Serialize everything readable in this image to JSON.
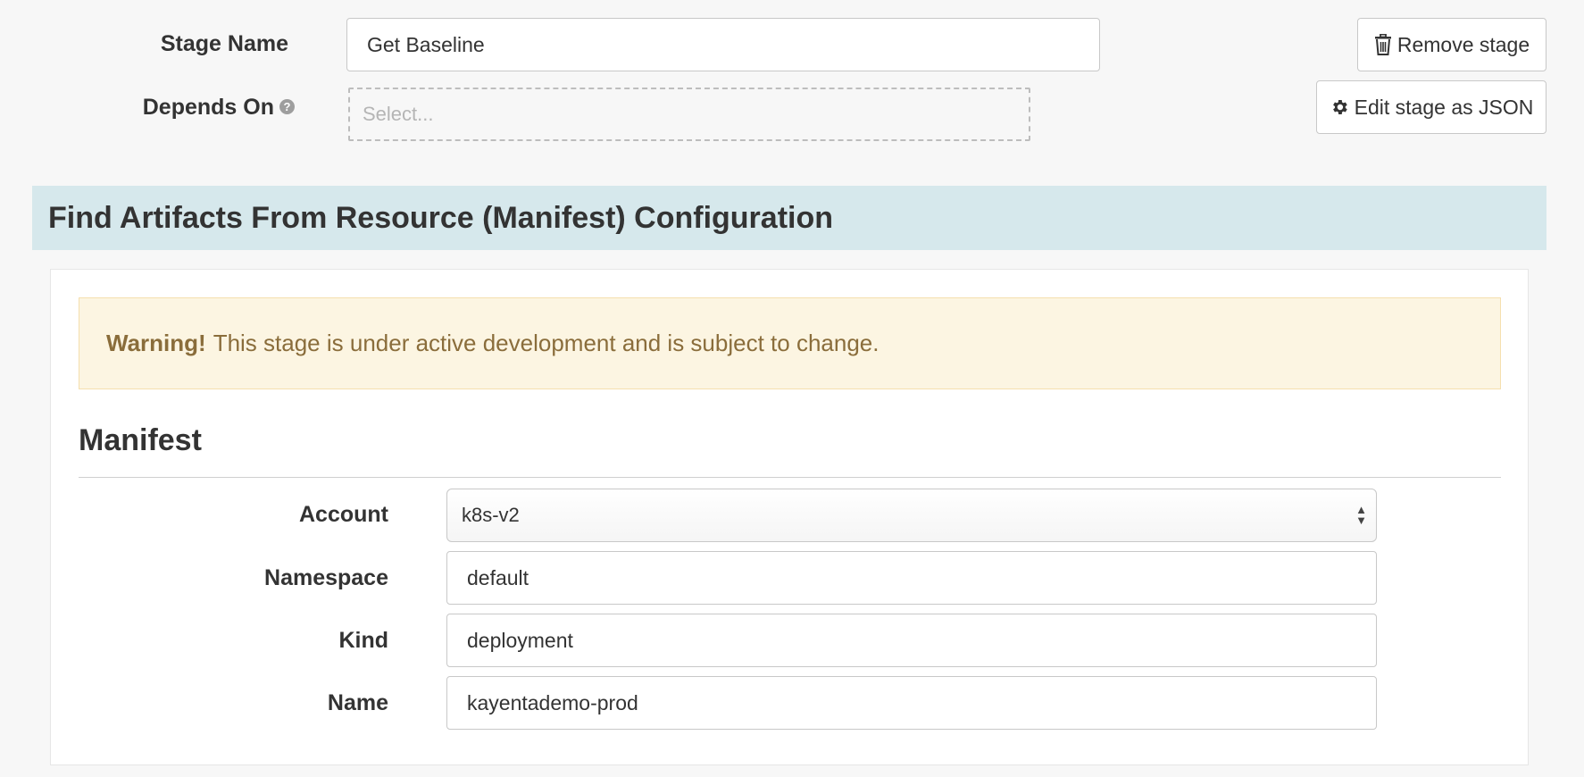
{
  "stage": {
    "name_label": "Stage Name",
    "name_value": "Get Baseline",
    "depends_label": "Depends On",
    "depends_placeholder": "Select...",
    "remove_button": "Remove stage",
    "edit_json_button": "Edit stage as JSON"
  },
  "section": {
    "title": "Find Artifacts From Resource (Manifest) Configuration"
  },
  "warning": {
    "strong": "Warning!",
    "text": "This stage is under active development and is subject to change."
  },
  "manifest": {
    "title": "Manifest",
    "account_label": "Account",
    "account_value": "k8s-v2",
    "namespace_label": "Namespace",
    "namespace_value": "default",
    "kind_label": "Kind",
    "kind_value": "deployment",
    "name_label": "Name",
    "name_value": "kayentademo-prod"
  },
  "icons": {
    "help": "question-circle-icon",
    "trash": "trash-icon",
    "gear": "gear-icon",
    "select_arrows": "up-down-arrows-icon"
  },
  "colors": {
    "section_header_bg": "#d6e8ec",
    "warning_bg": "#fcf5e2",
    "warning_border": "#f5dfae",
    "warning_text": "#8a6d3b",
    "page_bg": "#f7f7f7"
  }
}
